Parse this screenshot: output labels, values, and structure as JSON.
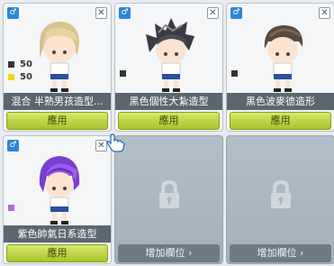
{
  "cards": [
    {
      "name": "混合 半熟男孩造型...",
      "apply_label": "應用",
      "gender_icon": "male-icon",
      "swatches": [
        {
          "color": "#333333",
          "value": "50"
        },
        {
          "color": "#f2d600",
          "value": "50"
        }
      ]
    },
    {
      "name": "黑色個性大紮造型",
      "apply_label": "應用",
      "gender_icon": "male-icon",
      "swatches": [
        {
          "color": "#333333",
          "value": ""
        }
      ]
    },
    {
      "name": "黑色波麥德造形",
      "apply_label": "應用",
      "gender_icon": "male-icon",
      "swatches": [
        {
          "color": "#333333",
          "value": ""
        }
      ]
    },
    {
      "name": "紫色帥氣日系造型",
      "apply_label": "應用",
      "gender_icon": "male-icon",
      "swatches": [
        {
          "color": "#b26bd6",
          "value": ""
        }
      ]
    }
  ],
  "locked_slots": [
    {
      "label": "增加欄位 ›"
    },
    {
      "label": "增加欄位 ›"
    }
  ],
  "gender_symbol": "♂",
  "close_symbol": "✕",
  "colors": {
    "apply_button": "#b8cf35",
    "name_bar": "#5b6770",
    "locked_bg": "#aab7c1"
  }
}
